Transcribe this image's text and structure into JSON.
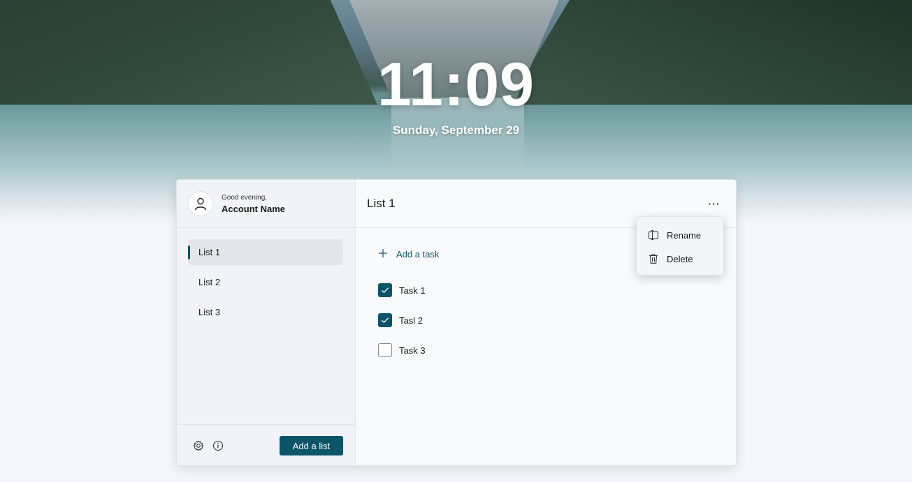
{
  "lockscreen": {
    "time": "11:09",
    "date": "Sunday, September 29"
  },
  "account": {
    "greeting": "Good evening,",
    "name": "Account Name"
  },
  "sidebar": {
    "items": [
      {
        "label": "List 1",
        "selected": true
      },
      {
        "label": "List 2",
        "selected": false
      },
      {
        "label": "List 3",
        "selected": false
      }
    ],
    "add_list_label": "Add a list"
  },
  "main": {
    "title": "List 1",
    "add_task_label": "Add a task",
    "more_label": "···",
    "tasks": [
      {
        "label": "Task 1",
        "checked": true
      },
      {
        "label": "Tasl 2",
        "checked": true
      },
      {
        "label": "Task 3",
        "checked": false
      }
    ]
  },
  "context_menu": {
    "items": [
      {
        "label": "Rename",
        "icon": "rename-icon"
      },
      {
        "label": "Delete",
        "icon": "trash-icon"
      }
    ]
  },
  "colors": {
    "accent": "#0c5568"
  }
}
